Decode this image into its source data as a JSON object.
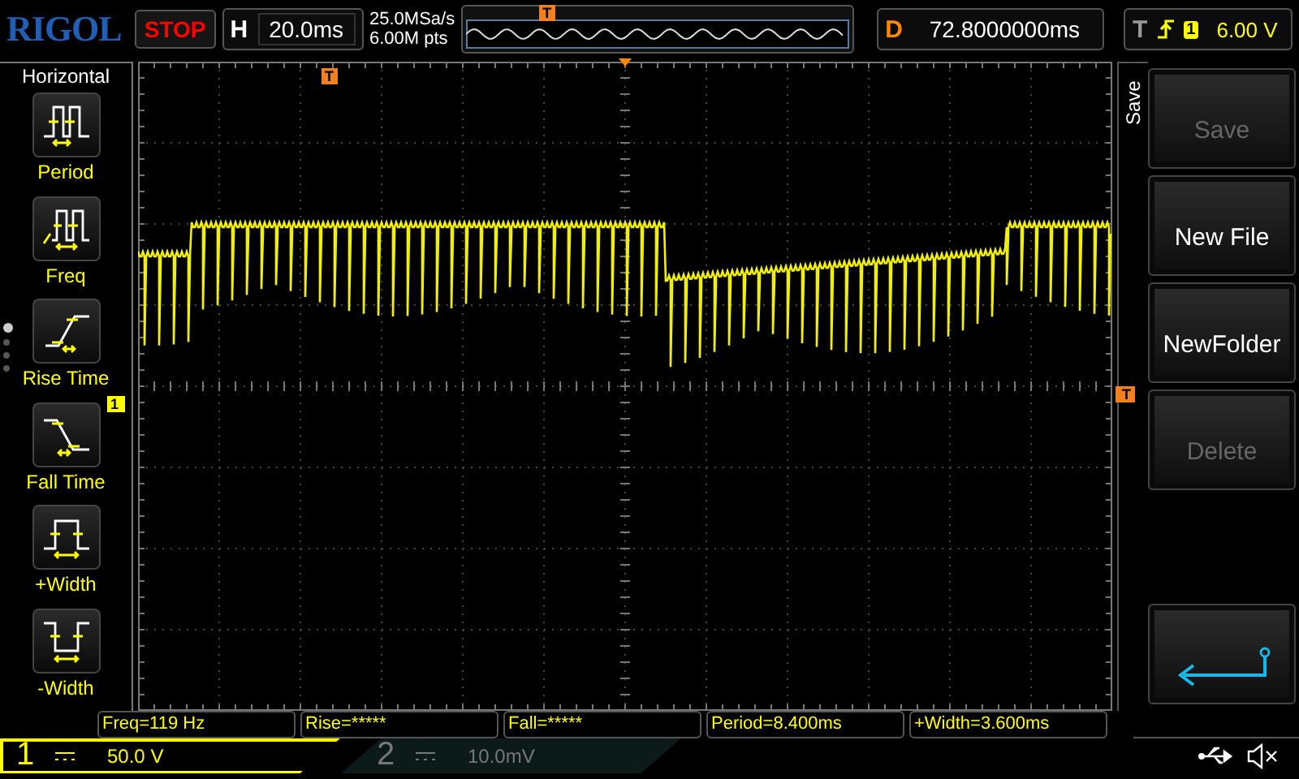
{
  "logo": "RIGOL",
  "run_state": "STOP",
  "horizontal": {
    "label": "H",
    "timebase": "20.0ms"
  },
  "acquisition": {
    "sample_rate": "25.0MSa/s",
    "memory_depth": "6.00M pts"
  },
  "memory_marker": "T",
  "delay": {
    "label": "D",
    "value": "72.8000000ms"
  },
  "trigger": {
    "label": "T",
    "source": "1",
    "level": "6.00 V"
  },
  "measure_menu": {
    "title": "Horizontal",
    "items": [
      {
        "kind": "period",
        "label": "Period"
      },
      {
        "kind": "freq",
        "label": "Freq"
      },
      {
        "kind": "rise",
        "label": "Rise Time"
      },
      {
        "kind": "fall",
        "label": "Fall Time"
      },
      {
        "kind": "pwidth",
        "label": "+Width"
      },
      {
        "kind": "nwidth",
        "label": "-Width"
      }
    ],
    "pages": [
      {
        "selected": true
      },
      {
        "selected": false
      },
      {
        "selected": false
      },
      {
        "selected": false
      }
    ]
  },
  "screen": {
    "trigger_position_marker": "T",
    "channel_marker": "1",
    "trigger_level_marker": "T"
  },
  "save_menu": {
    "title": "Save",
    "buttons": [
      {
        "kind": "text",
        "label": "Save",
        "disabled": true
      },
      {
        "kind": "text",
        "label": "New File",
        "disabled": false
      },
      {
        "kind": "text",
        "label": "NewFolder",
        "disabled": false
      },
      {
        "kind": "text",
        "label": "Delete",
        "disabled": true
      },
      {
        "kind": "back"
      }
    ]
  },
  "measurements": [
    "Freq=119 Hz",
    "Rise=*****",
    "Fall=*****",
    "Period=8.400ms",
    "+Width=3.600ms"
  ],
  "channels": [
    {
      "number": "1",
      "scale": "50.0 V",
      "on": true
    },
    {
      "number": "2",
      "scale": "10.0mV",
      "on": false
    }
  ]
}
